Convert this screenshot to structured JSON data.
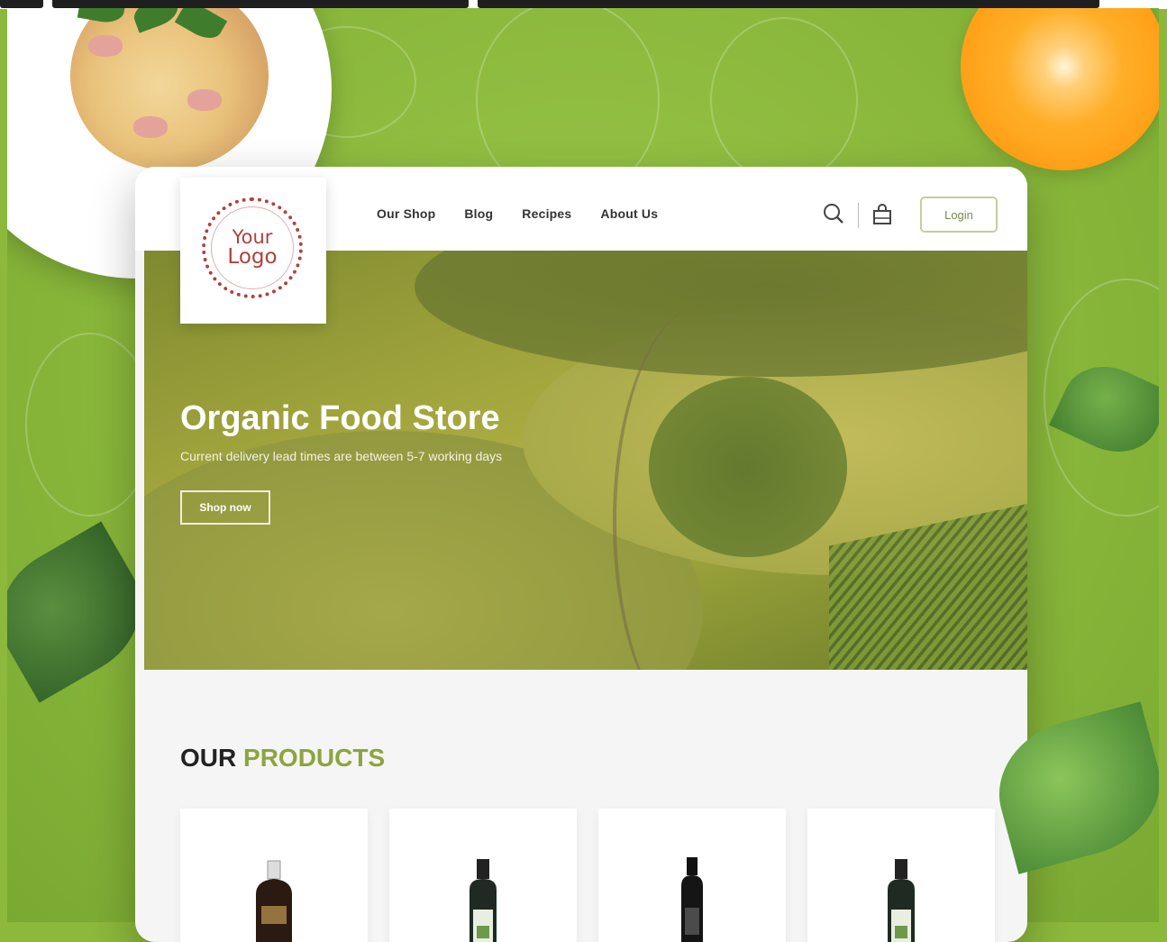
{
  "header": {
    "logo": {
      "line1": "Your",
      "line2": "Logo"
    },
    "nav": [
      "Our Shop",
      "Blog",
      "Recipes",
      "About Us"
    ],
    "icons": [
      "search-icon",
      "shopping-bag-icon"
    ],
    "login_label": "Login"
  },
  "hero": {
    "title": "Organic Food Store",
    "subtitle": "Current delivery lead times are between 5-7 working days",
    "cta_label": "Shop now"
  },
  "products": {
    "title_part1": "OUR",
    "title_part2": "PRODUCTS",
    "items": [
      {
        "type": "bottle",
        "style": "dark-round"
      },
      {
        "type": "bottle",
        "style": "dark-label"
      },
      {
        "type": "bottle",
        "style": "slim-dark"
      },
      {
        "type": "bottle",
        "style": "dark-label"
      }
    ]
  },
  "colors": {
    "background_green": "#8cb83c",
    "accent_olive": "#8ba53d",
    "logo_red": "#b0413e"
  }
}
